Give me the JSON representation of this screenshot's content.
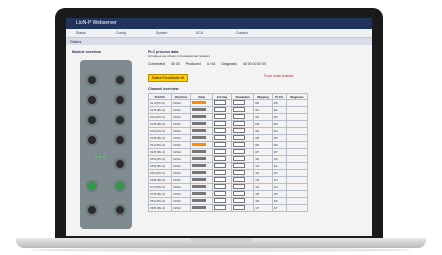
{
  "window": {
    "title": "LioN-P Webserver"
  },
  "menu": {
    "items": [
      "Status",
      "Config",
      "System",
      "SCU",
      "Contact"
    ]
  },
  "page": {
    "heading": "Status"
  },
  "left_panel": {
    "title": "Module overview"
  },
  "plc": {
    "title": "PLC process data",
    "note": "All values are shown in hexadecimal notation",
    "connected_label": "Connected",
    "connected_value": "00 00",
    "produced_label": "Produced",
    "produced_value": "4 / 64",
    "diagnosis_label": "Diagnosis",
    "diagnosis_value": "40 00 00 00 00",
    "switch_button": "Switch ForceMode off",
    "force_status": "Force mode enabled"
  },
  "channel_overview": {
    "title": "Channel overview",
    "headers": [
      "Port/Ch.",
      "Direction",
      "State",
      "Forcing",
      "Simulation",
      "Mapping",
      "Pr.Ctr.",
      "Diagnosis"
    ],
    "rows": [
      [
        "X1 A (Pin 4)",
        "In/Out",
        "",
        "",
        "",
        "0/0",
        "0/0",
        ""
      ],
      [
        "X1 B (Pin 2)",
        "In/Out",
        "",
        "",
        "",
        "0/1",
        "0/1",
        ""
      ],
      [
        "X2 A (Pin 4)",
        "In/Out",
        "",
        "",
        "",
        "0/2",
        "0/2",
        ""
      ],
      [
        "X2 B (Pin 2)",
        "In/Out",
        "",
        "",
        "",
        "0/3",
        "0/3",
        ""
      ],
      [
        "X3 A (Pin 4)",
        "In/Out",
        "",
        "",
        "",
        "0/4",
        "0/4",
        ""
      ],
      [
        "X3 B (Pin 2)",
        "In/Out",
        "",
        "",
        "",
        "0/5",
        "0/5",
        ""
      ],
      [
        "X4 A (Pin 4)",
        "In/Out",
        "",
        "",
        "",
        "0/6",
        "0/6",
        ""
      ],
      [
        "X4 B (Pin 2)",
        "In/Out",
        "",
        "",
        "",
        "0/7",
        "0/7",
        ""
      ],
      [
        "X5 A (Pin 4)",
        "In/Out",
        "",
        "",
        "",
        "1/0",
        "1/0",
        ""
      ],
      [
        "X5 B (Pin 2)",
        "In/Out",
        "",
        "",
        "",
        "1/1",
        "1/1",
        ""
      ],
      [
        "X6 A (Pin 4)",
        "In/Out",
        "",
        "",
        "",
        "1/2",
        "1/2",
        ""
      ],
      [
        "X6 B (Pin 2)",
        "In/Out",
        "",
        "",
        "",
        "1/3",
        "1/3",
        ""
      ],
      [
        "X7 A (Pin 4)",
        "In/Out",
        "",
        "",
        "",
        "1/4",
        "1/4",
        ""
      ],
      [
        "X7 B (Pin 2)",
        "In/Out",
        "",
        "",
        "",
        "1/5",
        "1/5",
        ""
      ],
      [
        "X8 A (Pin 4)",
        "In/Out",
        "",
        "",
        "",
        "1/6",
        "1/6",
        ""
      ],
      [
        "X8 B (Pin 2)",
        "In/Out",
        "",
        "",
        "",
        "1/7",
        "1/7",
        ""
      ]
    ]
  }
}
